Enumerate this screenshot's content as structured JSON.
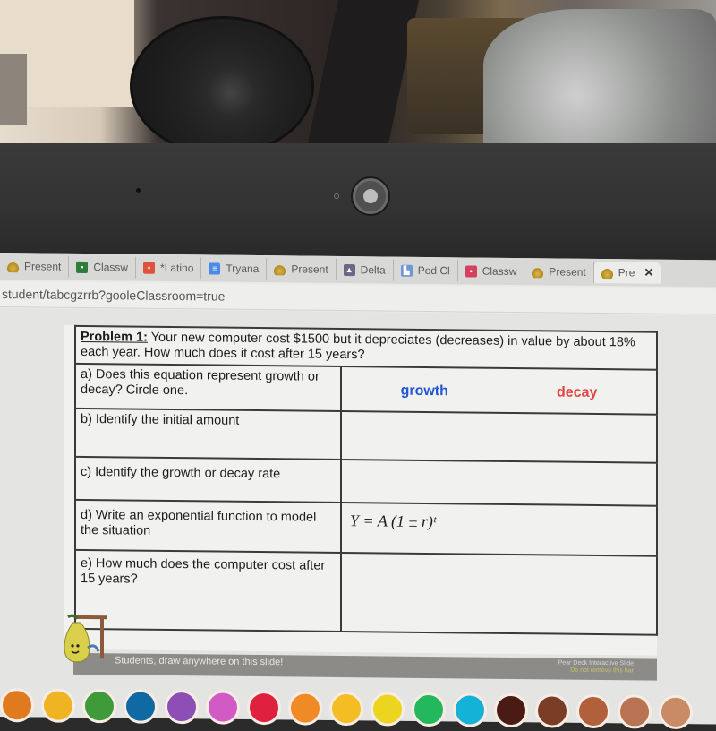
{
  "browser": {
    "tabs": [
      {
        "label": "Present",
        "icon": "pear-deck-icon",
        "active": false
      },
      {
        "label": "Classw",
        "icon": "google-classroom-icon",
        "active": false
      },
      {
        "label": "*Latino",
        "icon": "google-classroom-icon",
        "active": false
      },
      {
        "label": "Tryana",
        "icon": "google-docs-icon",
        "active": false
      },
      {
        "label": "Present",
        "icon": "pear-deck-icon",
        "active": false
      },
      {
        "label": "Delta",
        "icon": "deltamath-icon",
        "active": false
      },
      {
        "label": "Pod Cl",
        "icon": "chart-icon",
        "active": false
      },
      {
        "label": "Classw",
        "icon": "google-classroom-icon",
        "active": false
      },
      {
        "label": "Present",
        "icon": "pear-deck-icon",
        "active": false
      },
      {
        "label": "Pre",
        "icon": "pear-deck-icon",
        "active": true
      }
    ],
    "url": "student/tabcgzrrb?gooleClassroom=true",
    "close_glyph": "✕"
  },
  "worksheet": {
    "problem_label": "Problem 1:",
    "problem_text": " Your new computer cost $1500 but it depreciates (decreases) in value by about 18% each year. How much does it cost after 15 years?",
    "rows": [
      {
        "question": "a) Does this equation represent growth or decay? Circle one.",
        "answer": ""
      },
      {
        "question": "b) Identify the initial amount",
        "answer": ""
      },
      {
        "question": "c) Identify the growth or decay rate",
        "answer": ""
      },
      {
        "question": "d) Write an exponential function to model the situation",
        "answer": "Y = A (1 ± r)ᵗ"
      },
      {
        "question": "e) How much does the computer cost after 15 years?",
        "answer": ""
      }
    ],
    "choices": {
      "growth": "growth",
      "decay": "decay"
    },
    "colors": {
      "growth": "#2356d4",
      "decay": "#e0443f"
    }
  },
  "peardeck": {
    "draw_prompt": "Students, draw anywhere on this slide!",
    "slide_label": "Pear Deck Interactive Slide",
    "slide_warning": "Do not remove this bar"
  },
  "palette": {
    "colors": [
      "#e07a1f",
      "#f0b323",
      "#3f9a3a",
      "#0f6aa3",
      "#8d4fb5",
      "#d15ac4",
      "#e0203f",
      "#f08a25",
      "#f5bd24",
      "#ecd51e",
      "#22b85b",
      "#14b2d6",
      "#4a1a14",
      "#7a3e26",
      "#b0603a",
      "#b87352",
      "#c98a66"
    ]
  }
}
